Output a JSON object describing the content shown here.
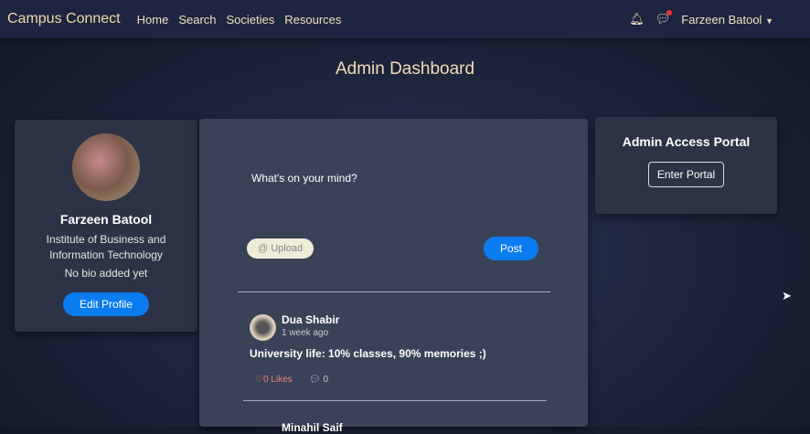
{
  "nav": {
    "brand": "Campus Connect",
    "links": [
      "Home",
      "Search",
      "Societies",
      "Resources"
    ],
    "user": "Farzeen Batool"
  },
  "page_title": "Admin Dashboard",
  "profile": {
    "name": "Farzeen Batool",
    "institution": "Institute of Business and Information Technology",
    "bio": "No bio added yet",
    "edit": "Edit Profile"
  },
  "composer": {
    "placeholder": "What's on your mind?",
    "upload": "@ Upload",
    "post": "Post"
  },
  "posts": [
    {
      "author": "Dua Shabir",
      "time": "1 week ago",
      "text": "University life: 10% classes, 90% memories ;)",
      "likes": "0 Likes",
      "comments": "0"
    },
    {
      "author": "Minahil Saif"
    }
  ],
  "portal": {
    "title": "Admin Access Portal",
    "button": "Enter Portal"
  }
}
